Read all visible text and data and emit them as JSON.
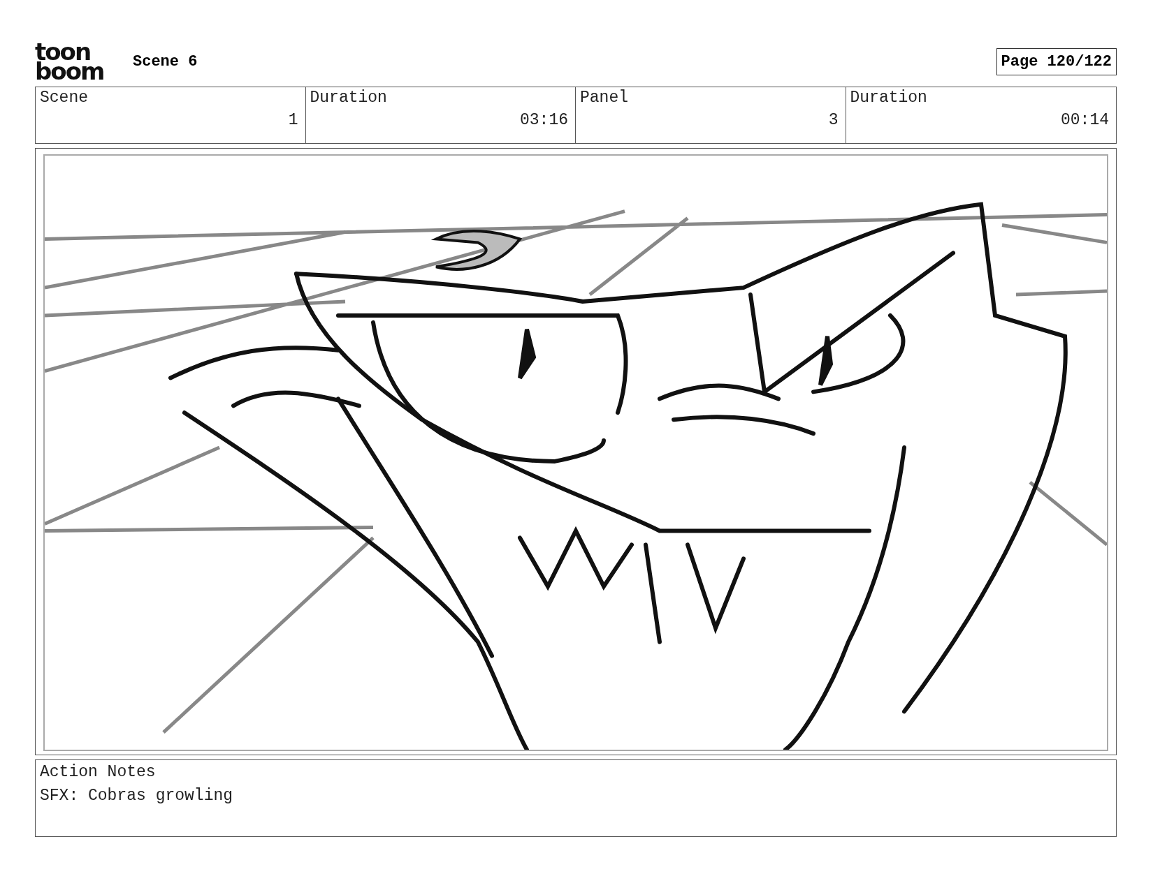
{
  "header": {
    "logo": [
      "toon",
      "boom"
    ],
    "title": "Scene 6",
    "page": "Page 120/122"
  },
  "info_table": {
    "columns": [
      "Scene",
      "Duration",
      "Panel",
      "Duration"
    ],
    "values": [
      "1",
      "03:16",
      "3",
      "00:14"
    ]
  },
  "notes": {
    "title": "Action Notes",
    "text": "SFX: Cobras growling"
  }
}
